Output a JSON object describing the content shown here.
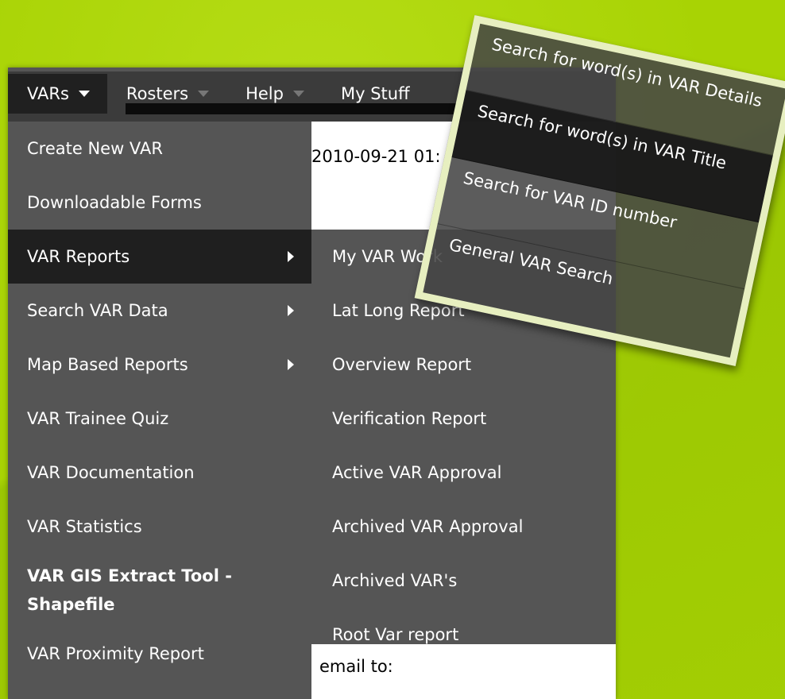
{
  "top_menu": [
    {
      "label": "VARs",
      "active": true
    },
    {
      "label": "Rosters"
    },
    {
      "label": "Help"
    },
    {
      "label": "My Stuff"
    }
  ],
  "page": {
    "timestamp_partial": "2010-09-21 01:",
    "email_label": "email to:"
  },
  "vars_menu": {
    "items": [
      "Create New VAR",
      "Downloadable Forms",
      "VAR Reports",
      "Search VAR Data",
      "Map Based Reports",
      "VAR Trainee Quiz",
      "VAR Documentation",
      "VAR Statistics",
      "VAR GIS Extract Tool - Shapefile",
      "VAR Proximity Report"
    ]
  },
  "reports_submenu": {
    "items": [
      "My VAR Work",
      "Lat Long Report",
      "Overview Report",
      "Verification Report",
      "Active VAR Approval",
      "Archived VAR Approval",
      "Archived VAR's",
      "Root Var report"
    ]
  },
  "search_popup": {
    "items": [
      "Search for word(s) in VAR Details",
      "Search for word(s) in VAR Title",
      "Search for VAR ID number",
      "General VAR Search"
    ]
  },
  "colors": {
    "background": "#a8d304",
    "menu_bg": "#555555",
    "menu_highlight": "#1f1f1f",
    "topbar": "#3b3b3b",
    "popup_border": "#e7efc0"
  },
  "icons": {
    "caret_down": "caret-down-icon",
    "submenu_arrow": "chevron-right-icon"
  }
}
